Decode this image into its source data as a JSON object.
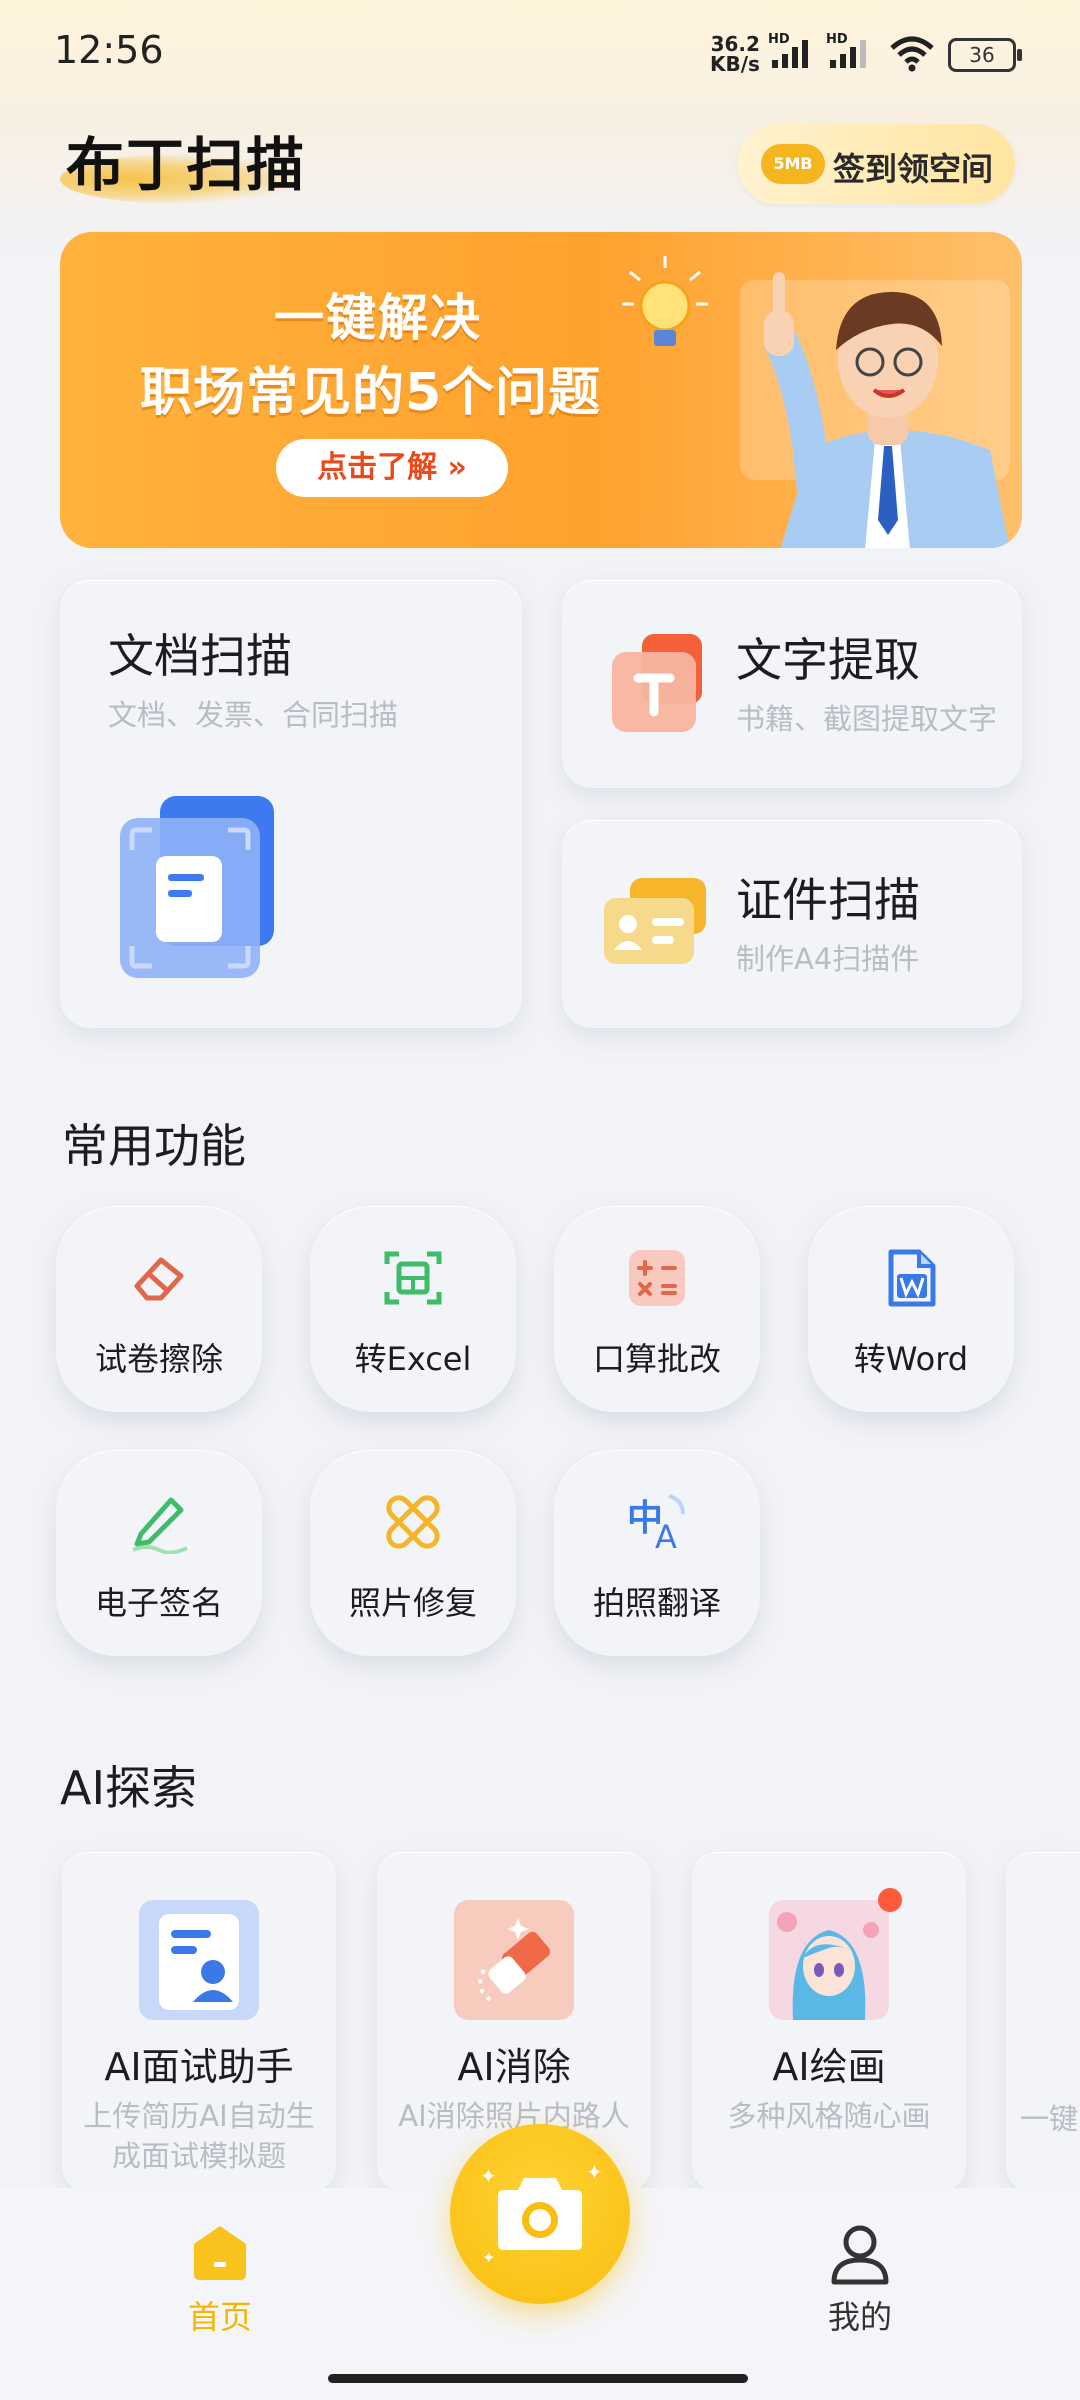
{
  "status_bar": {
    "time": "12:56",
    "net_speed_top": "36.2",
    "net_speed_unit": "KB/s",
    "hd1": "HD",
    "hd2": "HD",
    "battery": "36"
  },
  "header": {
    "app_name": "布丁扫描",
    "checkin_badge": "5MB",
    "checkin_label": "签到领空间"
  },
  "banner": {
    "line1": "一键解决",
    "line2": "职场常见的5个问题",
    "cta": "点击了解 »"
  },
  "features": [
    {
      "title": "文档扫描",
      "subtitle": "文档、发票、合同扫描"
    },
    {
      "title": "文字提取",
      "subtitle": "书籍、截图提取文字"
    },
    {
      "title": "证件扫描",
      "subtitle": "制作A4扫描件"
    }
  ],
  "common": {
    "title": "常用功能",
    "tools": [
      {
        "label": "试卷擦除",
        "icon": "eraser-icon"
      },
      {
        "label": "转Excel",
        "icon": "excel-icon"
      },
      {
        "label": "口算批改",
        "icon": "calculator-icon"
      },
      {
        "label": "转Word",
        "icon": "word-icon"
      },
      {
        "label": "电子签名",
        "icon": "pen-icon"
      },
      {
        "label": "照片修复",
        "icon": "bandage-icon"
      },
      {
        "label": "拍照翻译",
        "icon": "translate-icon"
      }
    ]
  },
  "ai": {
    "title": "AI探索",
    "cards": [
      {
        "title": "AI面试助手",
        "desc": "上传简历AI自动生成面试模拟题"
      },
      {
        "title": "AI消除",
        "desc": "AI消除照片内路人"
      },
      {
        "title": "AI绘画",
        "desc": "多种风格随心画"
      },
      {
        "title": "",
        "desc": "一键"
      }
    ]
  },
  "nav": {
    "home": "首页",
    "mine": "我的"
  },
  "colors": {
    "accent": "#f9be0f",
    "nav_active": "#f5b700"
  }
}
